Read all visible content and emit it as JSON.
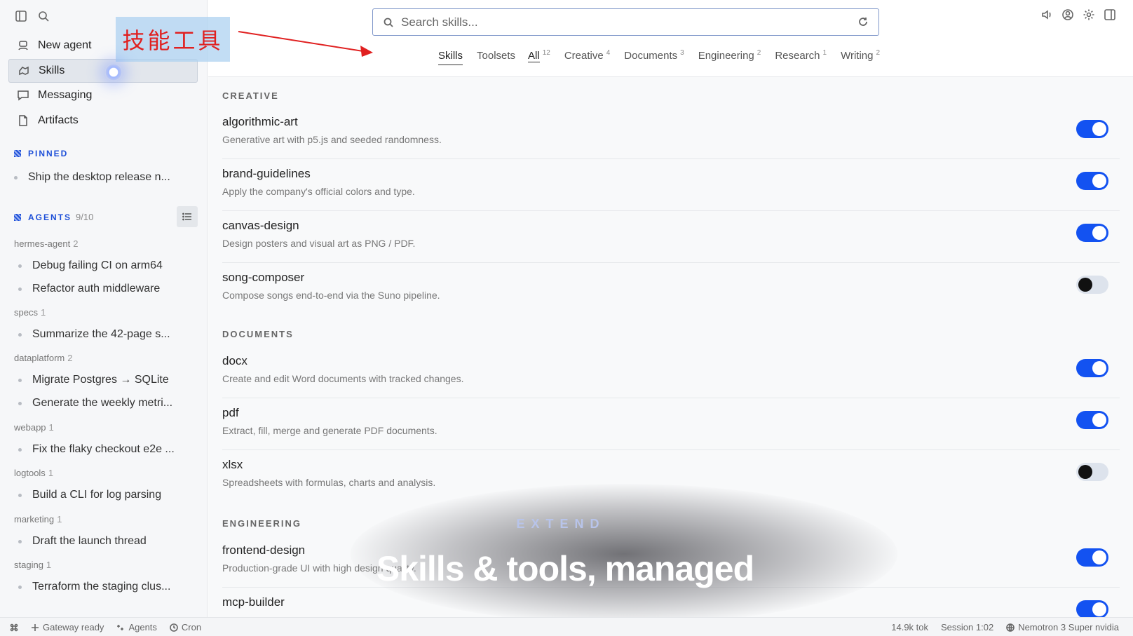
{
  "sidebar": {
    "nav": [
      {
        "label": "New agent",
        "icon": "agent-icon"
      },
      {
        "label": "Skills",
        "icon": "skills-icon"
      },
      {
        "label": "Messaging",
        "icon": "chat-icon"
      },
      {
        "label": "Artifacts",
        "icon": "document-icon"
      }
    ],
    "pinned": {
      "title": "PINNED",
      "items": [
        "Ship the desktop release n..."
      ]
    },
    "agents": {
      "title": "AGENTS",
      "count": "9/10",
      "groups": [
        {
          "name": "hermes-agent",
          "count": "2",
          "tasks": [
            "Debug failing CI on arm64",
            "Refactor auth middleware"
          ]
        },
        {
          "name": "specs",
          "count": "1",
          "tasks": [
            "Summarize the 42-page s..."
          ]
        },
        {
          "name": "dataplatform",
          "count": "2",
          "tasks": [
            "Migrate Postgres → SQLite",
            "Generate the weekly metri..."
          ]
        },
        {
          "name": "webapp",
          "count": "1",
          "tasks": [
            "Fix the flaky checkout e2e ..."
          ]
        },
        {
          "name": "logtools",
          "count": "1",
          "tasks": [
            "Build a CLI for log parsing"
          ]
        },
        {
          "name": "marketing",
          "count": "1",
          "tasks": [
            "Draft the launch thread"
          ]
        },
        {
          "name": "staging",
          "count": "1",
          "tasks": [
            "Terraform the staging clus..."
          ]
        }
      ]
    }
  },
  "annotation": {
    "label": "技能工具",
    "color": "#e02020"
  },
  "search": {
    "placeholder": "Search skills..."
  },
  "tabs": {
    "primary": [
      "Skills",
      "Toolsets"
    ],
    "filters": [
      {
        "label": "All",
        "count": "12"
      },
      {
        "label": "Creative",
        "count": "4"
      },
      {
        "label": "Documents",
        "count": "3"
      },
      {
        "label": "Engineering",
        "count": "2"
      },
      {
        "label": "Research",
        "count": "1"
      },
      {
        "label": "Writing",
        "count": "2"
      }
    ]
  },
  "categories": [
    {
      "title": "CREATIVE",
      "skills": [
        {
          "name": "algorithmic-art",
          "desc": "Generative art with p5.js and seeded randomness.",
          "enabled": true
        },
        {
          "name": "brand-guidelines",
          "desc": "Apply the company's official colors and type.",
          "enabled": true
        },
        {
          "name": "canvas-design",
          "desc": "Design posters and visual art as PNG / PDF.",
          "enabled": true
        },
        {
          "name": "song-composer",
          "desc": "Compose songs end-to-end via the Suno pipeline.",
          "enabled": false
        }
      ]
    },
    {
      "title": "DOCUMENTS",
      "skills": [
        {
          "name": "docx",
          "desc": "Create and edit Word documents with tracked changes.",
          "enabled": true
        },
        {
          "name": "pdf",
          "desc": "Extract, fill, merge and generate PDF documents.",
          "enabled": true
        },
        {
          "name": "xlsx",
          "desc": "Spreadsheets with formulas, charts and analysis.",
          "enabled": false
        }
      ]
    },
    {
      "title": "ENGINEERING",
      "skills": [
        {
          "name": "frontend-design",
          "desc": "Production-grade UI with high design quality.",
          "enabled": true
        },
        {
          "name": "mcp-builder",
          "desc": "",
          "enabled": true
        }
      ]
    }
  ],
  "caption": {
    "kicker": "EXTEND",
    "title": "Skills & tools, managed"
  },
  "statusbar": {
    "left": [
      {
        "label": "",
        "icon": "command-icon"
      },
      {
        "label": "Gateway ready",
        "icon": "sparkle-icon"
      },
      {
        "label": "Agents",
        "icon": "agents-icon"
      },
      {
        "label": "Cron",
        "icon": "clock-icon"
      }
    ],
    "right": [
      {
        "label": "14.9k tok"
      },
      {
        "label": "Session 1:02"
      },
      {
        "label": "Nemotron 3 Super nvidia",
        "icon": "model-icon"
      }
    ]
  },
  "colors": {
    "accent": "#1352f1",
    "section": "#1d4fd8"
  }
}
